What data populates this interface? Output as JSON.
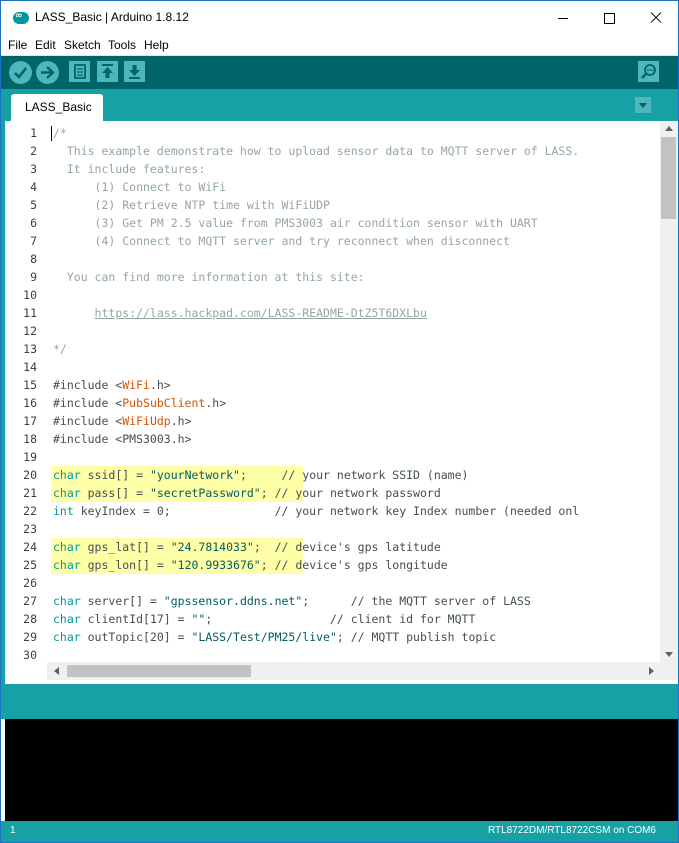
{
  "window": {
    "title": "LASS_Basic | Arduino 1.8.12",
    "logo_text": "∞"
  },
  "menu": [
    "File",
    "Edit",
    "Sketch",
    "Tools",
    "Help"
  ],
  "toolbar": {
    "buttons": [
      "verify",
      "upload",
      "new",
      "open",
      "save"
    ],
    "serial_monitor": "serial-monitor"
  },
  "tabs": [
    {
      "label": "LASS_Basic",
      "active": true
    }
  ],
  "editor": {
    "cursor_line": 1,
    "lines": [
      {
        "n": "1",
        "hl": 0,
        "seg": [
          {
            "t": "/*",
            "c": "cm"
          }
        ]
      },
      {
        "n": "2",
        "hl": 0,
        "seg": [
          {
            "t": "  This example demonstrate how to upload sensor data to MQTT server of LASS.",
            "c": "cm"
          }
        ]
      },
      {
        "n": "3",
        "hl": 0,
        "seg": [
          {
            "t": "  It include features:",
            "c": "cm"
          }
        ]
      },
      {
        "n": "4",
        "hl": 0,
        "seg": [
          {
            "t": "      (1) Connect to WiFi",
            "c": "cm"
          }
        ]
      },
      {
        "n": "5",
        "hl": 0,
        "seg": [
          {
            "t": "      (2) Retrieve NTP time with WiFiUDP",
            "c": "cm"
          }
        ]
      },
      {
        "n": "6",
        "hl": 0,
        "seg": [
          {
            "t": "      (3) Get PM 2.5 value from PMS3003 air condition sensor with UART",
            "c": "cm"
          }
        ]
      },
      {
        "n": "7",
        "hl": 0,
        "seg": [
          {
            "t": "      (4) Connect to MQTT server and try reconnect when disconnect",
            "c": "cm"
          }
        ]
      },
      {
        "n": "8",
        "hl": 0,
        "seg": []
      },
      {
        "n": "9",
        "hl": 0,
        "seg": [
          {
            "t": "  You can find more information at this site:",
            "c": "cm"
          }
        ]
      },
      {
        "n": "10",
        "hl": 0,
        "seg": []
      },
      {
        "n": "11",
        "hl": 0,
        "seg": [
          {
            "t": "      ",
            "c": "cm"
          },
          {
            "t": "https://lass.hackpad.com/LASS-README-DtZ5T6DXLbu",
            "c": "url"
          }
        ]
      },
      {
        "n": "12",
        "hl": 0,
        "seg": []
      },
      {
        "n": "13",
        "hl": 0,
        "seg": [
          {
            "t": "*/",
            "c": "cm"
          }
        ]
      },
      {
        "n": "14",
        "hl": 0,
        "seg": []
      },
      {
        "n": "15",
        "hl": 0,
        "seg": [
          {
            "t": "#include <",
            "c": ""
          },
          {
            "t": "WiFi",
            "c": "lib"
          },
          {
            "t": ".h>",
            "c": ""
          }
        ]
      },
      {
        "n": "16",
        "hl": 0,
        "seg": [
          {
            "t": "#include <",
            "c": ""
          },
          {
            "t": "PubSubClient",
            "c": "lib"
          },
          {
            "t": ".h>",
            "c": ""
          }
        ]
      },
      {
        "n": "17",
        "hl": 0,
        "seg": [
          {
            "t": "#include <",
            "c": ""
          },
          {
            "t": "WiFiUdp",
            "c": "lib"
          },
          {
            "t": ".h>",
            "c": ""
          }
        ]
      },
      {
        "n": "18",
        "hl": 0,
        "seg": [
          {
            "t": "#include <PMS3003.h>",
            "c": ""
          }
        ]
      },
      {
        "n": "19",
        "hl": 0,
        "seg": []
      },
      {
        "n": "20",
        "hl": 252,
        "seg": [
          {
            "t": "char",
            "c": "kw"
          },
          {
            "t": " ssid[] = ",
            "c": ""
          },
          {
            "t": "\"yourNetwork\"",
            "c": "str"
          },
          {
            "t": ";     // your network SSID (name)",
            "c": ""
          }
        ]
      },
      {
        "n": "21",
        "hl": 252,
        "seg": [
          {
            "t": "char",
            "c": "kw"
          },
          {
            "t": " pass[] = ",
            "c": ""
          },
          {
            "t": "\"secretPassword\"",
            "c": "str"
          },
          {
            "t": "; // your network password",
            "c": ""
          }
        ]
      },
      {
        "n": "22",
        "hl": 0,
        "seg": [
          {
            "t": "int",
            "c": "kw"
          },
          {
            "t": " keyIndex = 0;               // your network key Index number (needed onl",
            "c": ""
          }
        ]
      },
      {
        "n": "23",
        "hl": 0,
        "seg": []
      },
      {
        "n": "24",
        "hl": 252,
        "seg": [
          {
            "t": "char",
            "c": "kw"
          },
          {
            "t": " gps_lat[] = ",
            "c": ""
          },
          {
            "t": "\"24.7814033\"",
            "c": "str"
          },
          {
            "t": ";  // device's gps latitude",
            "c": ""
          }
        ]
      },
      {
        "n": "25",
        "hl": 252,
        "seg": [
          {
            "t": "char",
            "c": "kw"
          },
          {
            "t": " gps_lon[] = ",
            "c": ""
          },
          {
            "t": "\"120.9933676\"",
            "c": "str"
          },
          {
            "t": "; // device's gps longitude",
            "c": ""
          }
        ]
      },
      {
        "n": "26",
        "hl": 0,
        "seg": []
      },
      {
        "n": "27",
        "hl": 0,
        "seg": [
          {
            "t": "char",
            "c": "kw"
          },
          {
            "t": " server[] = ",
            "c": ""
          },
          {
            "t": "\"gpssensor.ddns.net\"",
            "c": "str"
          },
          {
            "t": ";      // the MQTT server of LASS",
            "c": ""
          }
        ]
      },
      {
        "n": "28",
        "hl": 0,
        "seg": [
          {
            "t": "char",
            "c": "kw"
          },
          {
            "t": " clientId[17] = ",
            "c": ""
          },
          {
            "t": "\"\"",
            "c": "str"
          },
          {
            "t": ";                 // client id for MQTT",
            "c": ""
          }
        ]
      },
      {
        "n": "29",
        "hl": 0,
        "seg": [
          {
            "t": "char",
            "c": "kw"
          },
          {
            "t": " outTopic[20] = ",
            "c": ""
          },
          {
            "t": "\"LASS/Test/PM25/live\"",
            "c": "str"
          },
          {
            "t": "; // MQTT publish topic",
            "c": ""
          }
        ]
      },
      {
        "n": "30",
        "hl": 0,
        "seg": []
      }
    ]
  },
  "status": {
    "line_number": "1",
    "board": "RTL8722DM/RTL8722CSM on COM6"
  },
  "colors": {
    "teal_dark": "#006468",
    "teal": "#17a1a5",
    "button": "#4db7bb",
    "highlight": "#ffffa8",
    "comment": "#95a5a6",
    "keyword": "#00979c",
    "library": "#d35400",
    "string": "#005c5f"
  }
}
